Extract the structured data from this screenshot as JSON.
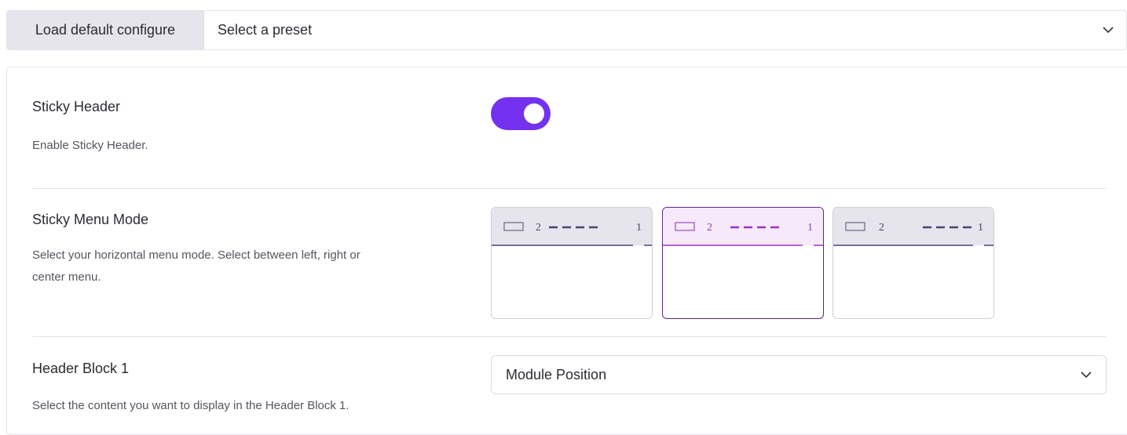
{
  "preset": {
    "label": "Load default configure",
    "select_value": "Select a preset"
  },
  "sticky_header": {
    "title": "Sticky Header",
    "description": "Enable Sticky Header.",
    "enabled": true,
    "accent_color": "#7431f0"
  },
  "sticky_menu_mode": {
    "title": "Sticky Menu Mode",
    "description_line1": "Select your horizontal menu mode. Select between left, right or",
    "description_line2": "center menu.",
    "options": [
      {
        "label_a": "2",
        "label_b": "1",
        "selected": false
      },
      {
        "label_a": "2",
        "label_b": "1",
        "selected": true
      },
      {
        "label_a": "2",
        "label_b": "1",
        "selected": false
      }
    ]
  },
  "header_block_1": {
    "title": "Header Block 1",
    "description": "Select the content you want to display in the Header Block 1.",
    "select_value": "Module Position"
  },
  "icons": {
    "preset_chevron": "chevron-down-icon",
    "block_chevron": "chevron-down-icon"
  }
}
